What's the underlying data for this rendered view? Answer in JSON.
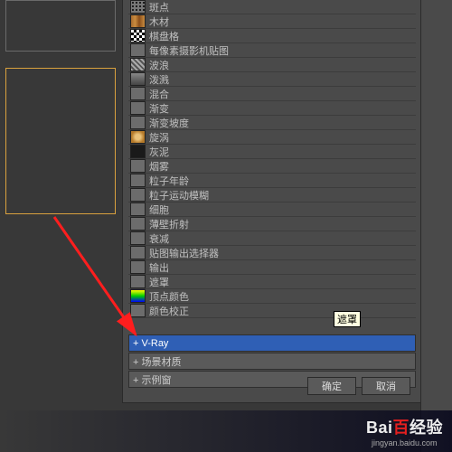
{
  "list": {
    "items": [
      {
        "label": "斑点",
        "swatch": "s-dots"
      },
      {
        "label": "木材",
        "swatch": "s-wood"
      },
      {
        "label": "棋盘格",
        "swatch": "s-checker"
      },
      {
        "label": "每像素摄影机贴图",
        "swatch": "s-gray"
      },
      {
        "label": "波浪",
        "swatch": "s-tile"
      },
      {
        "label": "泼溅",
        "swatch": "s-noise"
      },
      {
        "label": "混合",
        "swatch": "s-gray"
      },
      {
        "label": "渐变",
        "swatch": "s-gray"
      },
      {
        "label": "渐变坡度",
        "swatch": "s-gray"
      },
      {
        "label": "旋涡",
        "swatch": "s-swirl"
      },
      {
        "label": "灰泥",
        "swatch": "s-dark"
      },
      {
        "label": "烟雾",
        "swatch": "s-gray"
      },
      {
        "label": "粒子年龄",
        "swatch": "s-gray"
      },
      {
        "label": "粒子运动模糊",
        "swatch": "s-gray"
      },
      {
        "label": "细胞",
        "swatch": "s-gray"
      },
      {
        "label": "薄壁折射",
        "swatch": "s-gray"
      },
      {
        "label": "衰减",
        "swatch": "s-gray"
      },
      {
        "label": "贴图输出选择器",
        "swatch": "s-gray"
      },
      {
        "label": "输出",
        "swatch": "s-gray"
      },
      {
        "label": "遮罩",
        "swatch": "s-gray"
      },
      {
        "label": "顶点颜色",
        "swatch": "s-grad"
      },
      {
        "label": "颜色校正",
        "swatch": "s-gray"
      }
    ]
  },
  "tooltip": "遮罩",
  "categories": [
    {
      "label": "+ V-Ray",
      "selected": true
    },
    {
      "label": "+ 场景材质",
      "selected": false
    },
    {
      "label": "+ 示例窗",
      "selected": false
    }
  ],
  "buttons": {
    "ok": "确定",
    "cancel": "取消"
  },
  "watermark": {
    "brand_a": "Bai",
    "brand_b": "百",
    "brand_c": "经验",
    "url": "jingyan.baidu.com"
  }
}
